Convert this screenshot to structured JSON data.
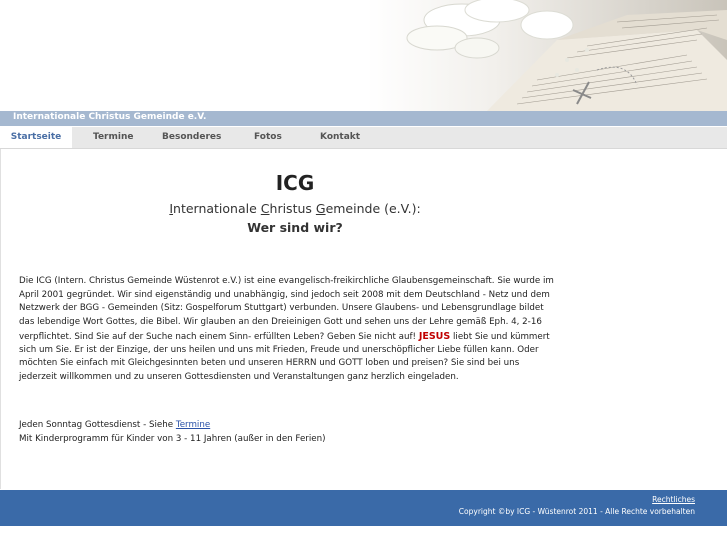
{
  "site": {
    "title_bar": "Internationale Christus Gemeinde e.V."
  },
  "nav": [
    {
      "label": "Startseite",
      "active": true
    },
    {
      "label": "Termine",
      "active": false
    },
    {
      "label": "Besonderes",
      "active": false
    },
    {
      "label": "Fotos",
      "active": false
    },
    {
      "label": "Kontakt",
      "active": false
    }
  ],
  "content": {
    "heading": "ICG",
    "subheading": {
      "p1": "I",
      "p2": "nternationale ",
      "p3": "C",
      "p4": "hristus ",
      "p5": "G",
      "p6": "emeinde (e.V.):"
    },
    "question": "Wer sind wir?",
    "intro_lines": [
      "Die ICG (Intern. Christus Gemeinde Wüstenrot e.V.) ist eine evangelisch-freikirchliche Glaubensgemeinschaft. Sie wurde im",
      "April 2001 gegründet. Wir sind eigenständig und unabhängig, sind jedoch seit 2008 mit dem Deutschland - Netz und dem",
      "Netzwerk der BGG - Gemeinden (Sitz: Gospelforum Stuttgart) verbunden. Unsere Glaubens- und Lebensgrundlage bildet",
      "das lebendige Wort Gottes, die Bibel. Wir glauben an den Dreieinigen Gott und sehen uns der Lehre gemäß Eph. 4, 2-16"
    ],
    "line5_pre": "verpflichtet. Sind Sie auf der Suche nach einem Sinn- erfüllten Leben? Geben Sie nicht auf! ",
    "line5_em": "JESUS",
    "line5_post": " liebt Sie und kümmert",
    "rest_lines": [
      "sich um Sie. Er ist der Einzige, der uns heilen und uns mit Frieden, Freude und unerschöpflicher Liebe füllen kann. Oder",
      "möchten Sie einfach mit Gleichgesinnten beten und unseren HERRN und GOTT loben und preisen? Sie sind bei uns",
      "jederzeit willkommen und zu unseren Gottesdiensten und Veranstaltungen ganz herzlich eingeladen."
    ],
    "sunday_pre": "Jeden Sonntag Gottesdienst - Siehe ",
    "sunday_link": "Termine",
    "kids": "Mit Kinderprogramm für Kinder von 3 - 11 Jahren (außer in den Ferien)"
  },
  "footer": {
    "legal_link": "Rechtliches",
    "copyright": "Copyright ©by ICG - Wüstenrot 2011 - Alle Rechte vorbehalten"
  },
  "colors": {
    "title_bar": "#a5b8d0",
    "nav_bg": "#e8e8e8",
    "nav_active_text": "#4a6fa5",
    "footer_bg": "#3a6aa8",
    "accent_red": "#c00000"
  }
}
